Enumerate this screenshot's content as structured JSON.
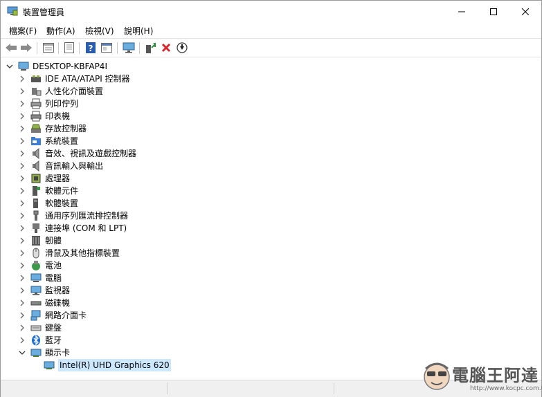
{
  "window": {
    "title": "裝置管理員"
  },
  "menubar": {
    "items": [
      "檔案(F)",
      "動作(A)",
      "檢視(V)",
      "說明(H)"
    ]
  },
  "toolbar": {
    "buttons": [
      "back-arrow-icon",
      "forward-arrow-icon",
      "properties-icon",
      "driver-icon",
      "help-icon",
      "action-icon",
      "monitor-icon",
      "update-driver-icon",
      "uninstall-icon",
      "download-icon"
    ],
    "colors": {
      "help": "#2a5db0",
      "uninstall": "#d9262a",
      "update": "#2a8f3a"
    }
  },
  "tree": {
    "root": "DESKTOP-KBFAP4I",
    "categories": [
      {
        "label": "IDE ATA/ATAPI 控制器",
        "icon": "ide-controller-icon"
      },
      {
        "label": "人性化介面裝置",
        "icon": "hid-icon"
      },
      {
        "label": "列印佇列",
        "icon": "print-queue-icon"
      },
      {
        "label": "印表機",
        "icon": "printer-icon"
      },
      {
        "label": "存放控制器",
        "icon": "storage-controller-icon"
      },
      {
        "label": "系統裝置",
        "icon": "system-folder-icon"
      },
      {
        "label": "音效、視訊及遊戲控制器",
        "icon": "speaker-icon"
      },
      {
        "label": "音訊輸入與輸出",
        "icon": "audio-io-icon"
      },
      {
        "label": "處理器",
        "icon": "processor-icon"
      },
      {
        "label": "軟體元件",
        "icon": "software-component-icon"
      },
      {
        "label": "軟體裝置",
        "icon": "software-device-icon"
      },
      {
        "label": "通用序列匯流排控制器",
        "icon": "usb-icon"
      },
      {
        "label": "連接埠 (COM 和 LPT)",
        "icon": "port-icon"
      },
      {
        "label": "韌體",
        "icon": "firmware-icon"
      },
      {
        "label": "滑鼠及其他指標裝置",
        "icon": "mouse-icon"
      },
      {
        "label": "電池",
        "icon": "battery-icon"
      },
      {
        "label": "電腦",
        "icon": "computer-icon"
      },
      {
        "label": "監視器",
        "icon": "monitor-icon"
      },
      {
        "label": "磁碟機",
        "icon": "disk-drive-icon"
      },
      {
        "label": "網路介面卡",
        "icon": "network-adapter-icon"
      },
      {
        "label": "鍵盤",
        "icon": "keyboard-icon"
      },
      {
        "label": "藍牙",
        "icon": "bluetooth-icon"
      },
      {
        "label": "顯示卡",
        "icon": "display-adapter-icon",
        "expanded": true
      }
    ],
    "child": "Intel(R) UHD Graphics 620"
  },
  "watermark": {
    "text": "電腦王阿達",
    "url": "http://www.kocpc.com.tw"
  }
}
